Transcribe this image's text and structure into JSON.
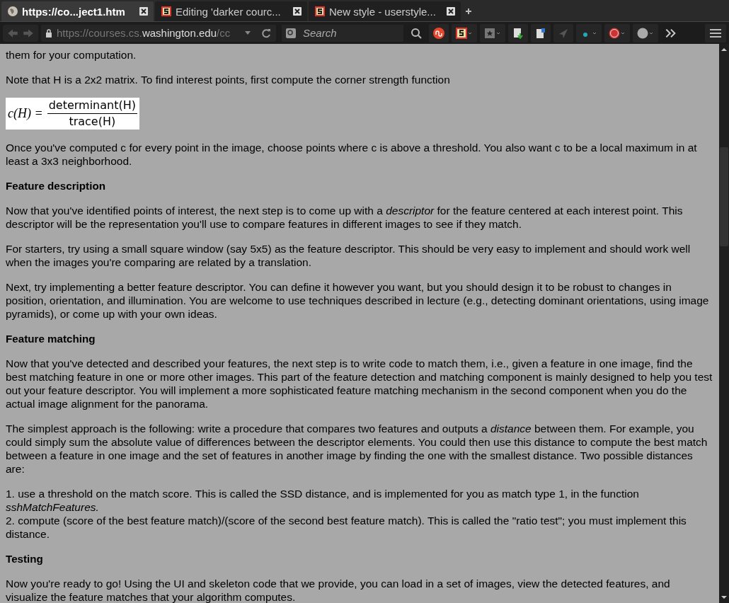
{
  "tabs": [
    {
      "label": "https://co...ject1.htm",
      "selected": true,
      "kind": "page"
    },
    {
      "label": "Editing 'darker courc...",
      "selected": false,
      "kind": "stylish"
    },
    {
      "label": "New style - userstyle...",
      "selected": false,
      "kind": "stylish"
    }
  ],
  "address_bar": {
    "url_prefix": "https://courses.cs.",
    "url_domain": "washington.edu",
    "url_suffix": "/cc"
  },
  "search": {
    "placeholder": "Search"
  },
  "content": [
    {
      "kind": "para",
      "text": "them for your computation."
    },
    {
      "kind": "para",
      "text": "Note that H is a 2x2 matrix.  To find interest points, first compute the corner strength function"
    },
    {
      "kind": "formula",
      "lhs": "c(H) =",
      "numerator": "determinant(H)",
      "denominator": "trace(H)"
    },
    {
      "kind": "para",
      "text": "Once you've computed c for every point in the image, choose points where c is above a threshold.  You also want c to be a local maximum in at least a 3x3 neighborhood."
    },
    {
      "kind": "heading",
      "text": "Feature description"
    },
    {
      "kind": "para",
      "text": "Now that you've identified points of interest, the next step is to come up with a *descriptor* for the feature centered at each interest point.  This descriptor will be the representation you'll use to compare features in different images to see if they match."
    },
    {
      "kind": "para",
      "text": "For starters, try using a small square window (say 5x5) as the feature descriptor.  This should be very easy to implement and should work well when the images you're comparing are related by a translation."
    },
    {
      "kind": "para",
      "text": "Next, try implementing a better feature descriptor.  You can define it however you want, but you should design it to be robust to changes in position, orientation, and illumination.  You are welcome to use techniques described in lecture (e.g., detecting dominant orientations, using image pyramids), or come up with your own ideas."
    },
    {
      "kind": "heading",
      "text": "Feature matching"
    },
    {
      "kind": "para",
      "text": "Now that you've detected and described your features, the next step is to write code to match them, i.e., given a feature in one image, find the best matching feature in one or more other images.  This part of the feature detection and matching component is mainly designed to help you test out your feature descriptor.  You will implement a more sophisticated feature matching mechanism in the second component when you do the actual image alignment for the panorama."
    },
    {
      "kind": "para",
      "text": "The simplest approach is the following:  write a procedure that compares two features and outputs a *distance* between them.  For example, you could simply sum the absolute value of differences between the descriptor elements. You could then use this distance to compute the best match between a feature in one image and the set of features in another image by finding the one with the smallest distance. Two possible distances are:"
    },
    {
      "kind": "lines",
      "lines": [
        "1.  use a threshold on the match score. This is called the SSD distance, and is implemented for you as match type 1, in the function *sshMatchFeatures.*",
        "2.  compute (score of the best feature match)/(score of the second best feature match). This is called the \"ratio test\"; you must implement this distance."
      ]
    },
    {
      "kind": "heading",
      "text": "Testing"
    },
    {
      "kind": "para",
      "text": "Now you're ready to go!  Using the UI and skeleton code that we provide, you can load in a set of images, view the detected features, and visualize the feature matches that your algorithm computes."
    }
  ]
}
